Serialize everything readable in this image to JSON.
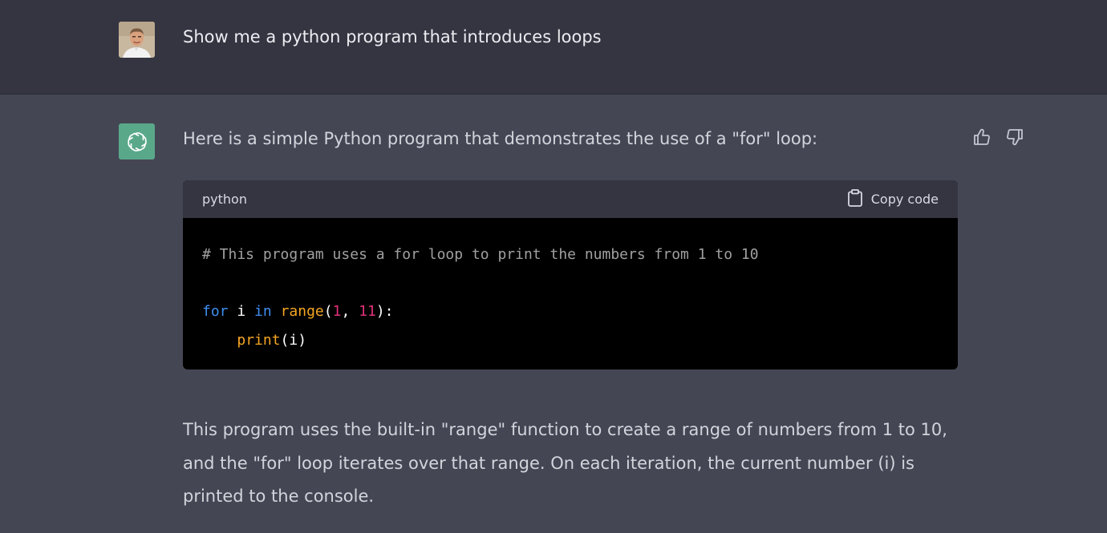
{
  "user_message": {
    "text": "Show me a python program that introduces loops"
  },
  "assistant_message": {
    "intro": "Here is a simple Python program that demonstrates the use of a \"for\" loop:",
    "code_block": {
      "language": "python",
      "copy_label": "Copy code",
      "lines": {
        "comment": "# This program uses a for loop to print the numbers from 1 to 10",
        "for_kw": "for",
        "var": " i ",
        "in_kw": "in",
        "range_fn": "range",
        "open_paren": "(",
        "num_start": "1",
        "comma": ", ",
        "num_end": "11",
        "close_colon": "):",
        "indent": "    ",
        "print_fn": "print",
        "print_args": "(i)"
      }
    },
    "explanation": "This program uses the built-in \"range\" function to create a range of numbers from 1 to 10, and the \"for\" loop iterates over that range. On each iteration, the current number (i) is printed to the console."
  },
  "icons": {
    "user_avatar": "user-photo-avatar",
    "assistant_avatar": "openai-logo-icon",
    "copy": "clipboard-icon",
    "thumbs_up": "thumbs-up-icon",
    "thumbs_down": "thumbs-down-icon"
  },
  "colors": {
    "user_row_bg": "#343541",
    "assistant_row_bg": "#444654",
    "assistant_avatar_bg": "#5aa88a",
    "code_bg": "#000000",
    "code_header_bg": "#343541",
    "keyword": "#3f8ef1",
    "function": "#f5a623",
    "number": "#df3079",
    "comment": "#a0a0a0"
  }
}
